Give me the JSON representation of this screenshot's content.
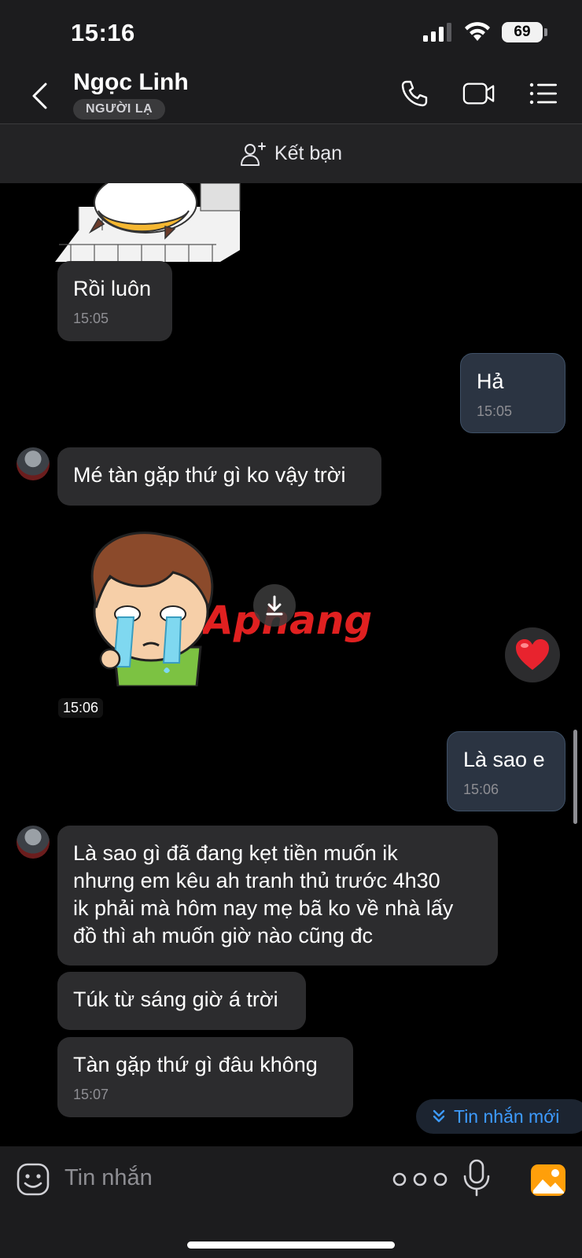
{
  "status_bar": {
    "time": "15:16",
    "battery": "69"
  },
  "header": {
    "name": "Ngọc Linh",
    "badge": "NGƯỜI LẠ"
  },
  "add_friend": {
    "label": "Kết bạn"
  },
  "messages": [
    {
      "dir": "in",
      "text": "Rồi luôn",
      "time": "15:05"
    },
    {
      "dir": "out",
      "text": "Hả",
      "time": "15:05"
    },
    {
      "dir": "in",
      "text": "Mé tàn gặp thứ gì ko vậy trời"
    },
    {
      "dir": "in",
      "type": "sticker",
      "watermark": "Aphang",
      "time": "15:06",
      "reaction": "heart"
    },
    {
      "dir": "out",
      "text": "Là sao e",
      "time": "15:06"
    },
    {
      "dir": "in",
      "lines": [
        "Là sao gì đã đang kẹt tiền muốn ik",
        "nhưng em kêu ah tranh thủ trước 4h30",
        "ik phải mà hôm nay mẹ bã ko về nhà lấy",
        "đồ thì ah muốn giờ nào cũng đc"
      ]
    },
    {
      "dir": "in",
      "text": "Túk từ sáng giờ á trời"
    },
    {
      "dir": "in",
      "text": "Tàn gặp thứ gì đâu không",
      "time": "15:07"
    }
  ],
  "new_messages_pill": "Tin nhắn mới",
  "input": {
    "placeholder": "Tin nhắn"
  },
  "colors": {
    "accent": "#3d9bff",
    "incoming_bubble": "#2c2c2e",
    "outgoing_bubble": "#2b3442",
    "photo_icon": "#ff9f0a"
  }
}
